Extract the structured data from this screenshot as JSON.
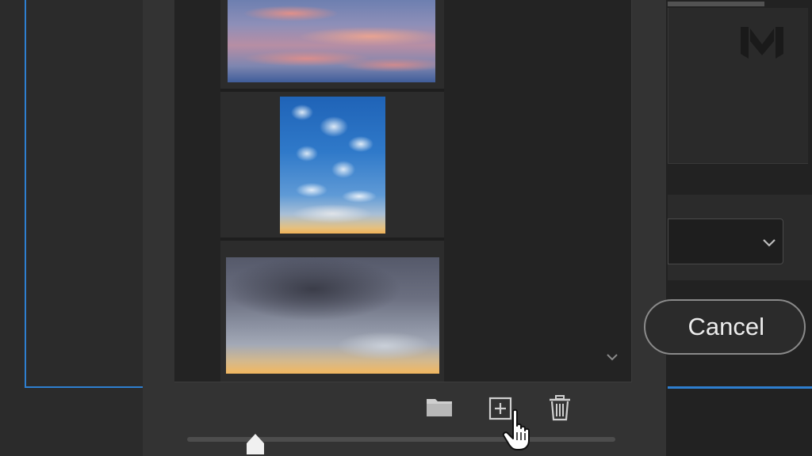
{
  "dialog": {
    "cancel_label": "Cancel"
  },
  "sky_list": {
    "items": [
      {
        "name": "pink-sunset-clouds-thumbnail"
      },
      {
        "name": "blue-sky-clouds-thumbnail"
      },
      {
        "name": "storm-clouds-thumbnail"
      }
    ]
  },
  "toolbar": {
    "icons": [
      "folder-icon",
      "add-icon",
      "trash-icon"
    ]
  },
  "thumbnail_size_slider": {
    "level_fraction": 0.16
  },
  "colors": {
    "accent": "#2e7fd0",
    "panel": "#333333",
    "list_bg": "#232323",
    "button_border": "#8a8a8a"
  }
}
